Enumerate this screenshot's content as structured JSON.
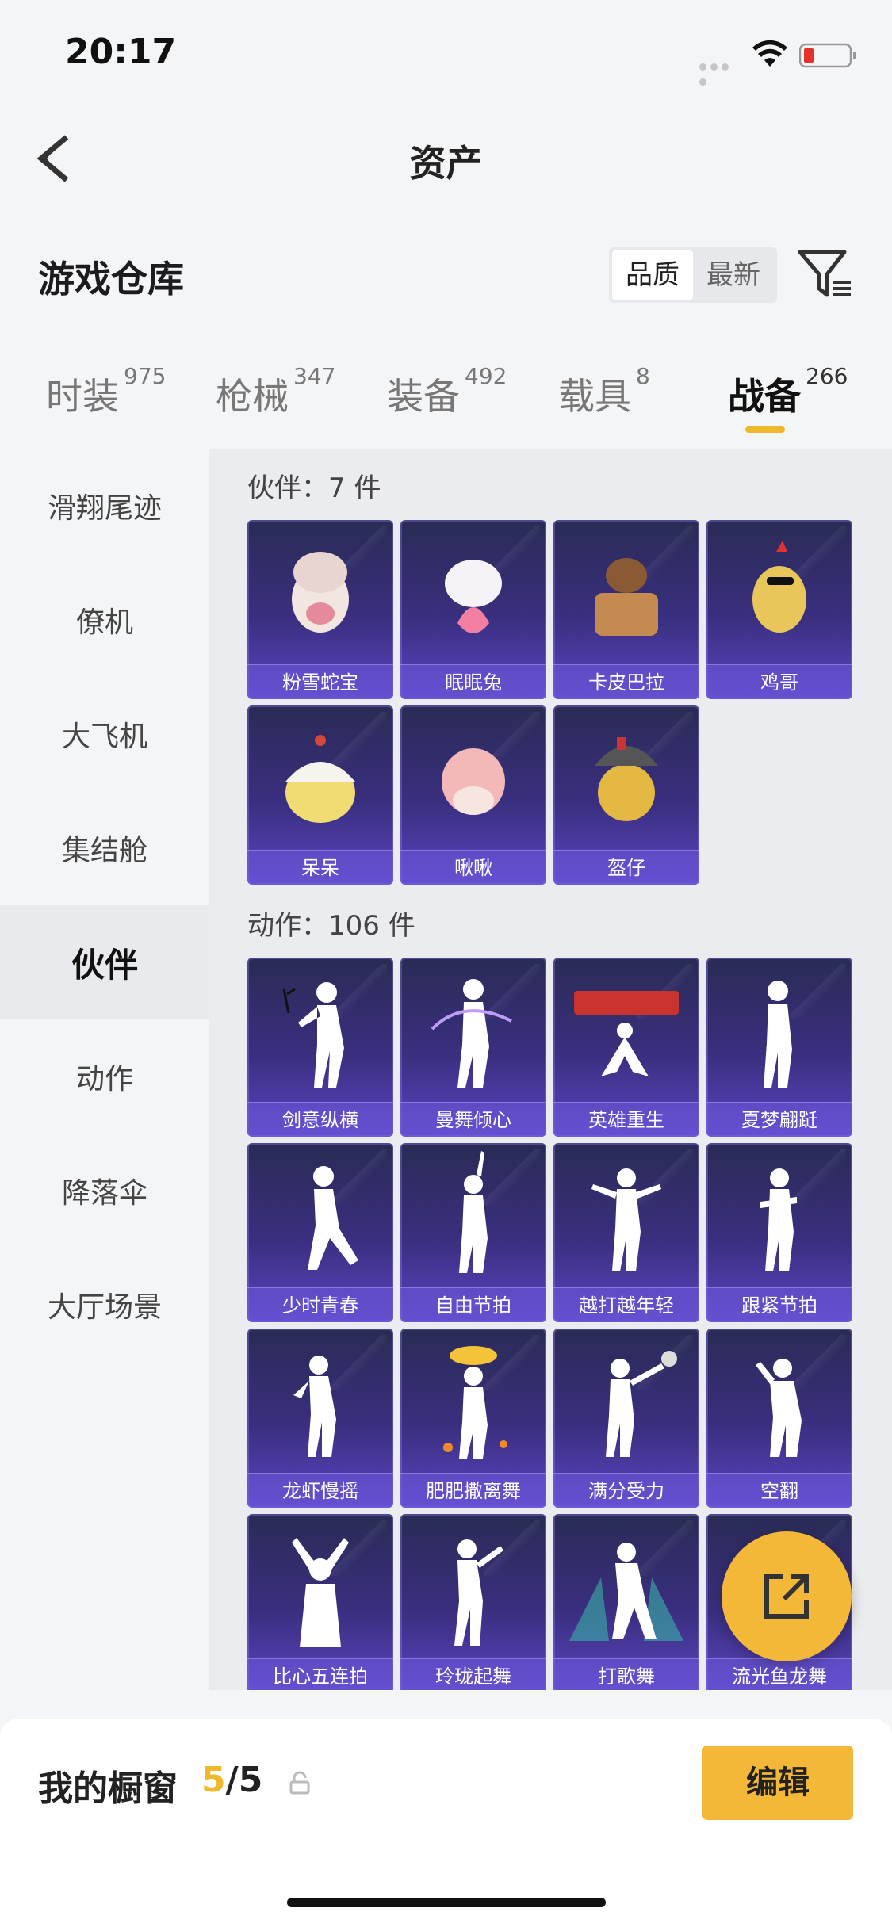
{
  "status_bar": {
    "time": "20:17"
  },
  "header": {
    "title": "资产",
    "back_icon": "back-arrow-icon"
  },
  "warehouse": {
    "title": "游戏仓库",
    "sort_options": [
      "品质",
      "最新"
    ],
    "active_sort": "品质",
    "filter_icon": "filter-icon"
  },
  "category_tabs": [
    {
      "label": "时装",
      "count": "975"
    },
    {
      "label": "枪械",
      "count": "347"
    },
    {
      "label": "装备",
      "count": "492"
    },
    {
      "label": "载具",
      "count": "8"
    },
    {
      "label": "战备",
      "count": "266",
      "active": true
    }
  ],
  "accent_color": "#f0b82b",
  "sidebar": {
    "items": [
      "滑翔尾迹",
      "僚机",
      "大飞机",
      "集结舱",
      "伙伴",
      "动作",
      "降落伞",
      "大厅场景"
    ],
    "active": "伙伴"
  },
  "groups": [
    {
      "title": "伙伴：7 件",
      "items": [
        "粉雪蛇宝",
        "眠眠兔",
        "卡皮巴拉",
        "鸡哥",
        "呆呆",
        "啾啾",
        "盔仔"
      ]
    },
    {
      "title": "动作：106 件",
      "items": [
        "剑意纵横",
        "曼舞倾心",
        "英雄重生",
        "夏梦翩跹",
        "少时青春",
        "自由节拍",
        "越打越年轻",
        "跟紧节拍",
        "龙虾慢摇",
        "肥肥撒离舞",
        "满分受力",
        "空翻",
        "比心五连拍",
        "玲珑起舞",
        "打歌舞",
        "流光鱼龙舞"
      ]
    }
  ],
  "fab": {
    "icon": "share-external-icon"
  },
  "showcase": {
    "title": "我的橱窗",
    "current": "5",
    "total": "/5",
    "lock_icon": "lock-icon",
    "edit_label": "编辑"
  }
}
